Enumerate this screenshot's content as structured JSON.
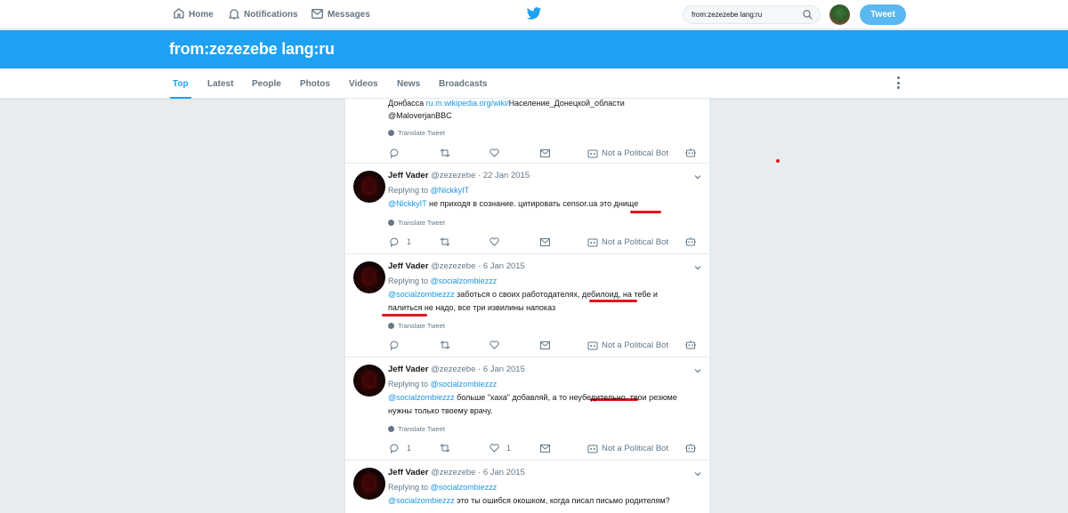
{
  "topnav": {
    "home_label": "Home",
    "notifications_label": "Notifications",
    "messages_label": "Messages",
    "search_value": "from:zezezebe lang:ru",
    "tweet_button": "Tweet"
  },
  "banner": {
    "title": "from:zezezebe lang:ru"
  },
  "tabs": [
    {
      "label": "Top",
      "active": true
    },
    {
      "label": "Latest"
    },
    {
      "label": "People"
    },
    {
      "label": "Photos"
    },
    {
      "label": "Videos"
    },
    {
      "label": "News"
    },
    {
      "label": "Broadcasts"
    }
  ],
  "colors": {
    "brand": "#1da1f2",
    "link": "#1b95e0",
    "annotation": "#e0161f"
  },
  "tweets": [
    {
      "text_pre": "Донбасса ",
      "text_link": "ru.m.wikipedia.org/wiki/",
      "text_post": "Население_Донецкой_области",
      "mention": "@MaloverjanBBC",
      "translate": "Translate Tweet",
      "not_political_bot": "Not a Political Bot"
    },
    {
      "name": "Jeff Vader",
      "handle": "@zezezebe",
      "date": "· 22 Jan 2015",
      "replying_label": "Replying to ",
      "replying_to": "@NickkyIT",
      "mention": "@NickkyIT",
      "text": " не приходя в сознание. цитировать censor.ua это днище",
      "translate": "Translate Tweet",
      "reply_count": "1",
      "like_count": "",
      "not_political_bot": "Not a Political Bot"
    },
    {
      "name": "Jeff Vader",
      "handle": "@zezezebe",
      "date": "· 6 Jan 2015",
      "replying_label": "Replying to ",
      "replying_to": "@socialzombiezzz",
      "mention": "@socialzombiezzz",
      "text_line1": " заботься о своих работодателях, дебилоид, на тебе и",
      "text_line2": "палиться не надо, все три извилины напоказ",
      "translate": "Translate Tweet",
      "not_political_bot": "Not a Political Bot"
    },
    {
      "name": "Jeff Vader",
      "handle": "@zezezebe",
      "date": "· 6 Jan 2015",
      "replying_label": "Replying to ",
      "replying_to": "@socialzombiezzz",
      "mention": "@socialzombiezzz",
      "text_line1": " больше \"хаха\" добавляй, а то неубедительно. твои резюме",
      "text_line2": "нужны только твоему врачу.",
      "translate": "Translate Tweet",
      "reply_count": "1",
      "like_count": "1",
      "not_political_bot": "Not a Political Bot"
    },
    {
      "name": "Jeff Vader",
      "handle": "@zezezebe",
      "date": "· 6 Jan 2015",
      "replying_label": "Replying to ",
      "replying_to": "@socialzombiezzz",
      "mention": "@socialzombiezzz",
      "text": " это ты ошибся окошком, когда писал письмо родителям?"
    }
  ]
}
